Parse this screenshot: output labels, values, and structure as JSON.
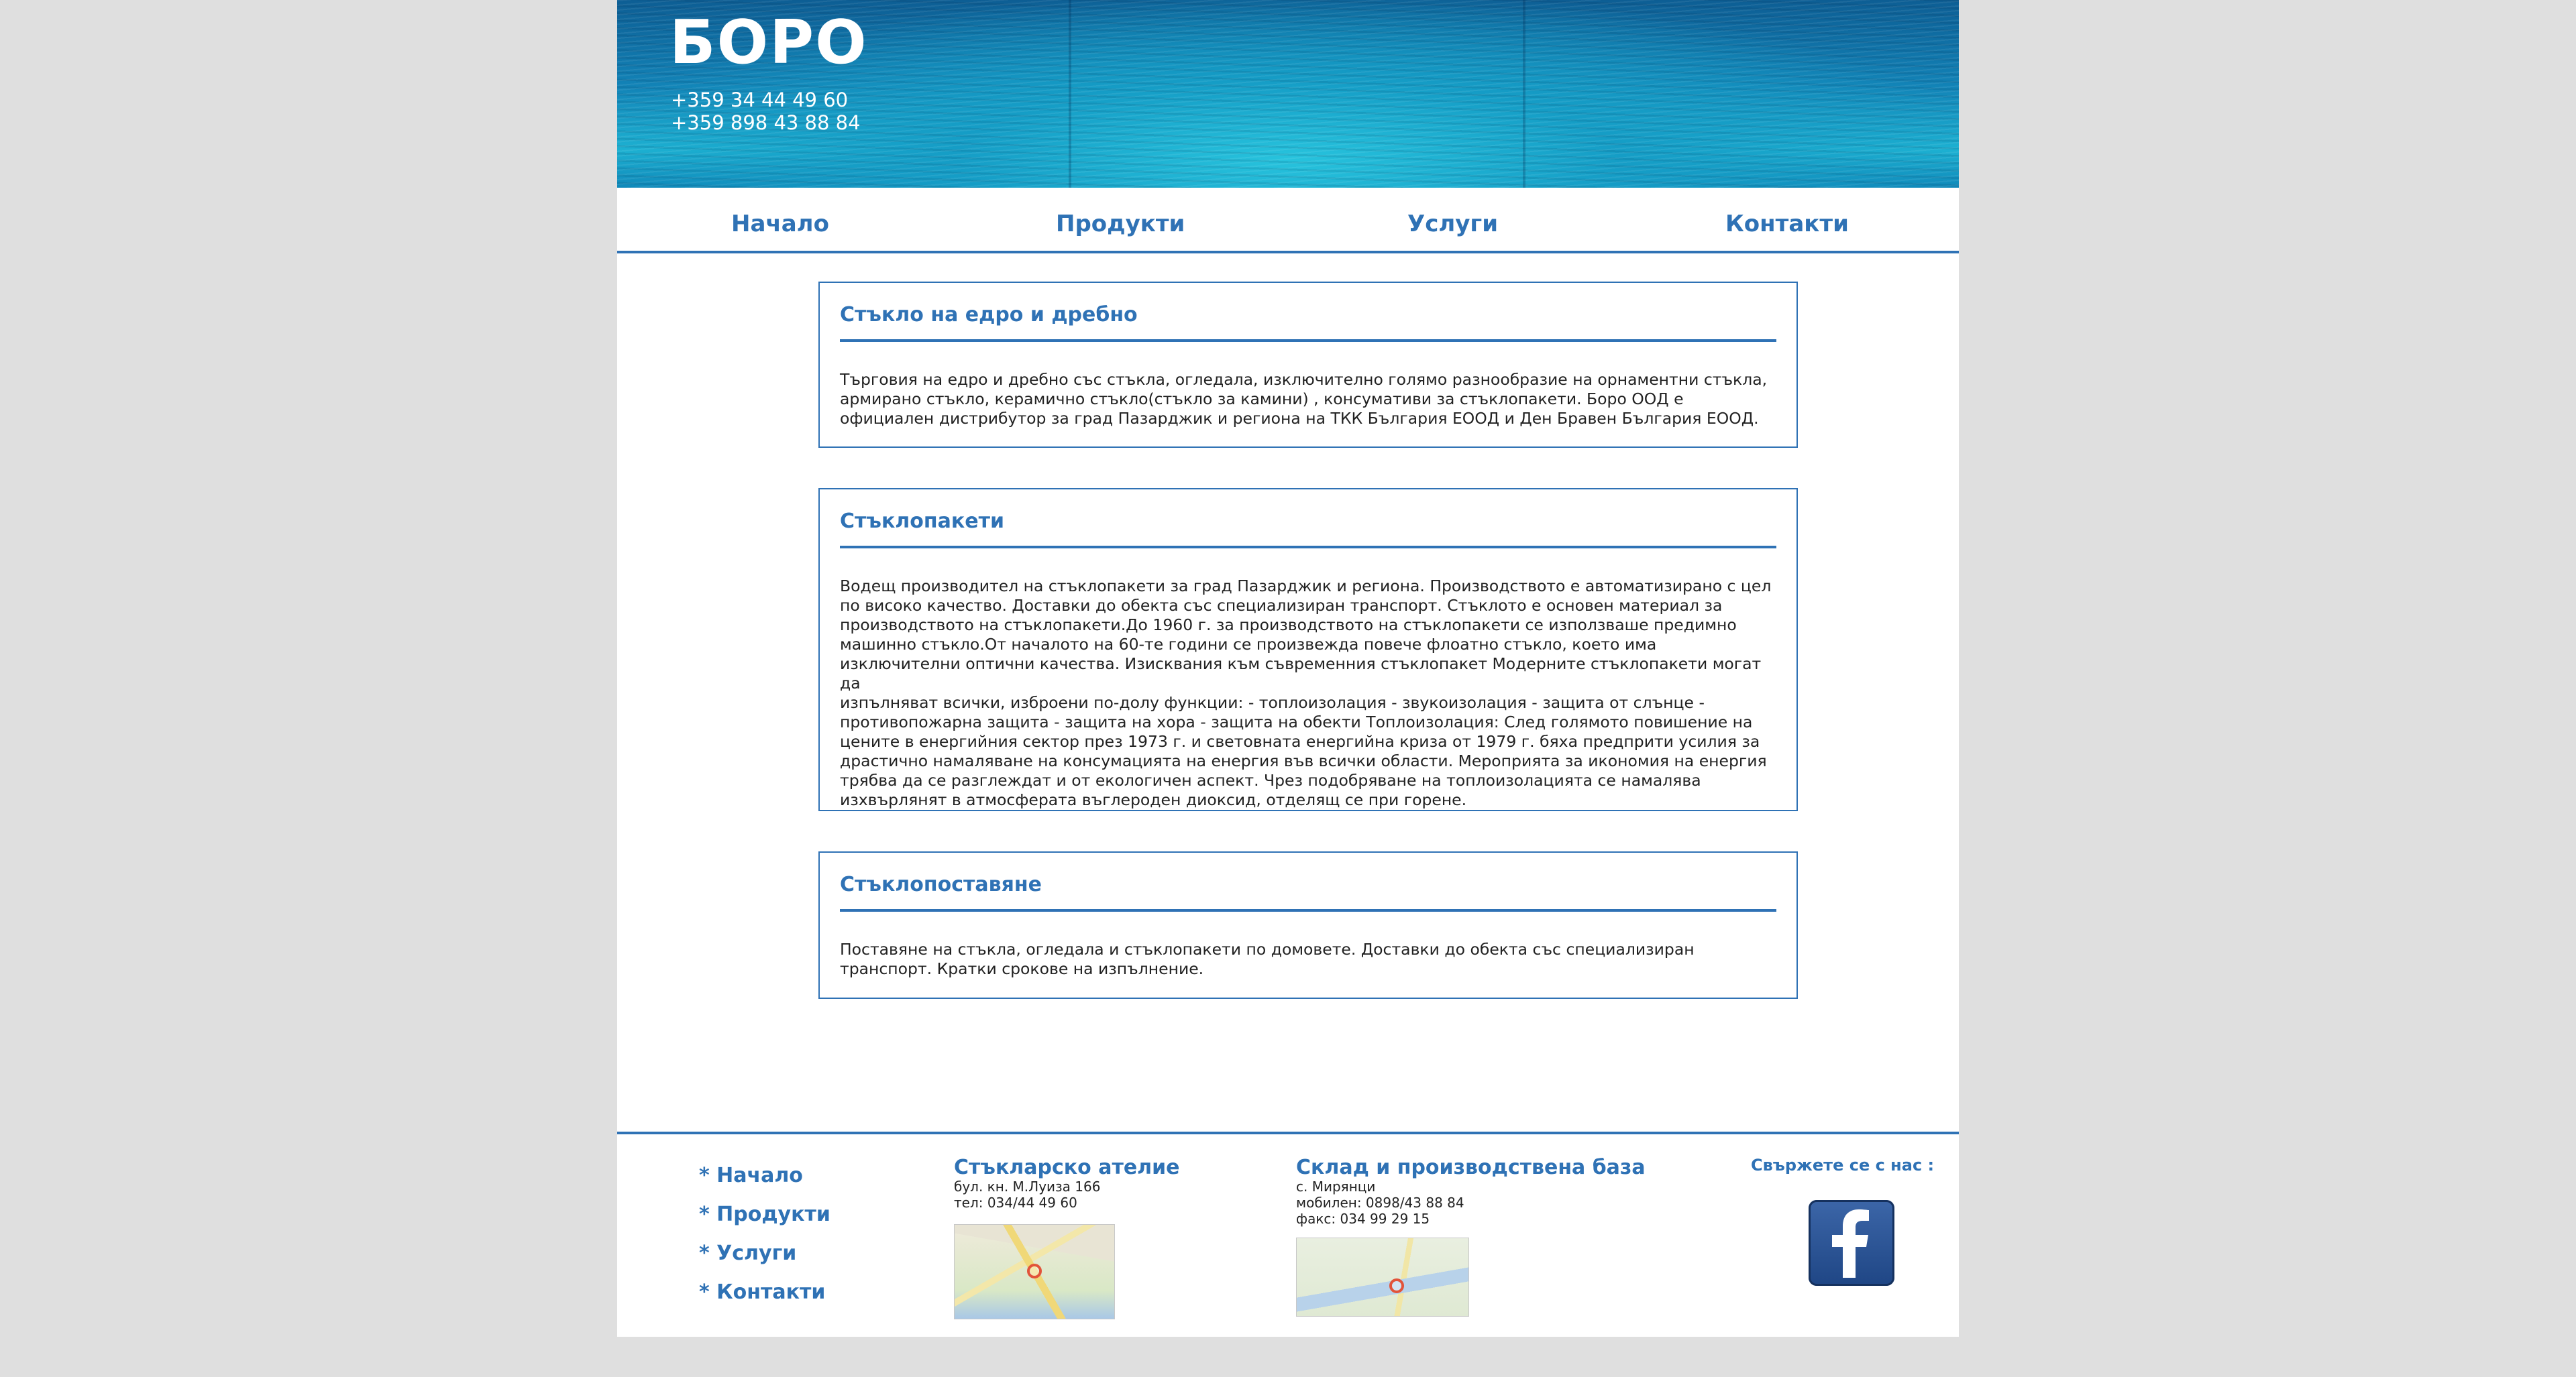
{
  "header": {
    "logo": "БОРО",
    "phones": [
      "+359 34 44 49 60",
      "+359 898 43 88 84"
    ]
  },
  "nav": {
    "items": [
      "Начало",
      "Продукти",
      "Услуги",
      "Контакти"
    ]
  },
  "sections": [
    {
      "title": "Стъкло на едро и дребно",
      "lines": [
        "Търговия на едро и дребно със стъкла, огледала, изключително голямо разнообразие на орнаментни стъкла,",
        "армирано стъкло, керамично стъкло(стъкло за камини) , консумативи за стъклопакети. Боро ООД е",
        "официален дистрибутор за град Пазарджик и региона на ТКК България ЕООД и Ден Бравен България ЕООД."
      ]
    },
    {
      "title": "Стъклопакети",
      "lines": [
        "Водещ производител на стъклопакети за град Пазарджик и региона. Производството е автоматизирано с цел",
        "по високо качество. Доставки до обекта със специализиран транспорт. Стъклото е основен материал за",
        "производството на стъклопакети.До 1960 г. за производството на стъклопакети се използваше предимно",
        "машинно стъкло.От началото на 60-те години се произвежда повече флоатно стъкло, което има",
        "изключителни оптични качества. Изисквания към съвременния стъклопакет Модерните стъклопакети могат да",
        "изпълняват всички, изброени по-долу функции: - топлоизолация - звукоизолация - защита от слънце -",
        "противопожарна защита - защита на хора - защита на обекти Топлоизолация: След голямото повишение на",
        "цените в енергийния сектор през 1973 г. и световната енергийна криза от 1979 г. бяха предприти усилия за",
        "драстично намаляване на консумацията на енергия във всички области. Мероприята за икономия на енергия",
        "трябва да се разглеждат и от екологичен аспект. Чрез подобряване на топлоизолацията се намалява",
        "изхвърлянят в атмосферата въглероден диоксид, отделящ се при горене."
      ]
    },
    {
      "title": "Стъклопоставяне",
      "lines": [
        "Поставяне на стъкла, огледала и стъклопакети по домовете. Доставки до обекта със специализиран",
        "транспорт. Кратки срокове на изпълнение."
      ]
    }
  ],
  "footer": {
    "nav": [
      "* Начало",
      "* Продукти",
      "* Услуги",
      "* Контакти"
    ],
    "atelier": {
      "title": "Стъкларско ателие",
      "lines": [
        "бул. кн. М.Луиза 166",
        "тел: 034/44 49 60"
      ]
    },
    "warehouse": {
      "title": "Склад и производствена база",
      "lines": [
        "с. Мирянци",
        "мобилен: 0898/43 88 84",
        "факс: 034 99 29 15"
      ]
    },
    "follow": "Свържете се с нас :",
    "facebook_icon": "facebook-icon"
  },
  "colors": {
    "accent": "#2f72b5",
    "page_bg": "#dfdfdf",
    "header_blue": "#1282b6"
  }
}
